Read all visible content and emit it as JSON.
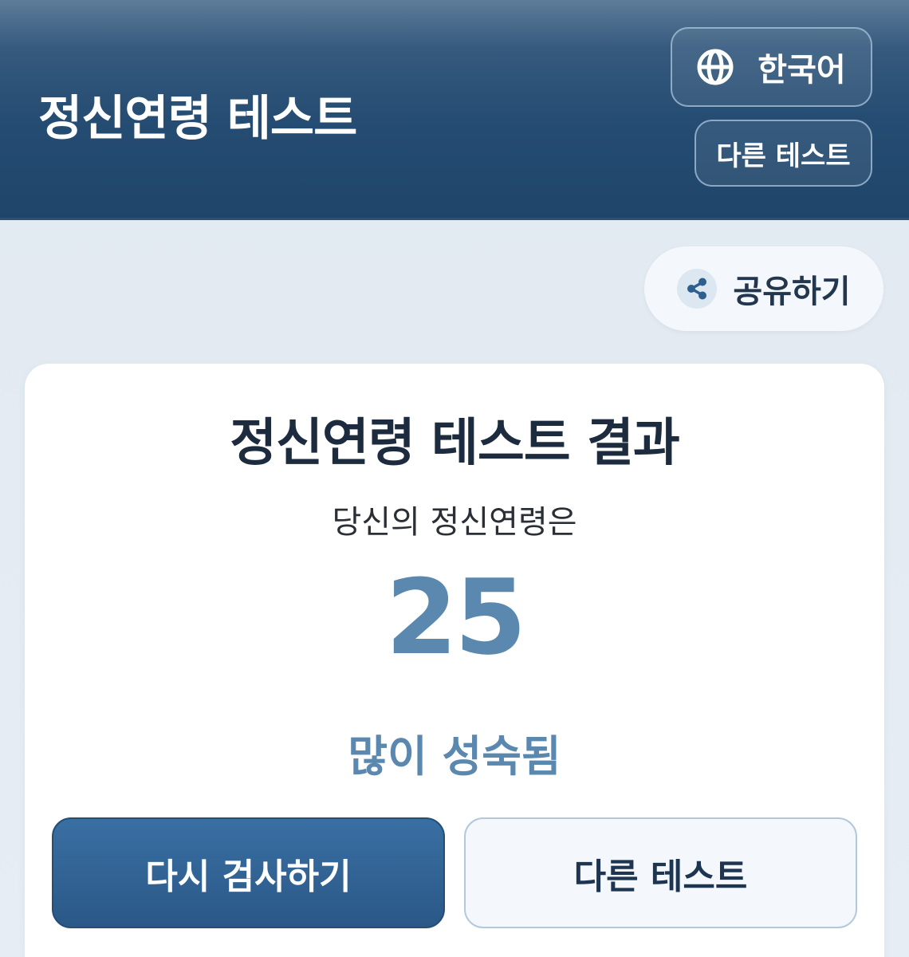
{
  "header": {
    "title": "정신연령 테스트",
    "language_button": {
      "label": "한국어",
      "icon": "globe-icon"
    },
    "other_tests_button": {
      "label": "다른 테스트"
    }
  },
  "share": {
    "label": "공유하기",
    "icon": "share-icon"
  },
  "result": {
    "title": "정신연령 테스트 결과",
    "subtitle": "당신의 정신연령은",
    "age": "25",
    "level": "많이 성숙됨"
  },
  "actions": {
    "retry_label": "다시 검사하기",
    "other_tests_label": "다른 테스트"
  },
  "colors": {
    "header": "#1f456a",
    "accent": "#5a88ae",
    "primary_button": "#2d5a8a",
    "page_background": "#e3eaf2"
  }
}
